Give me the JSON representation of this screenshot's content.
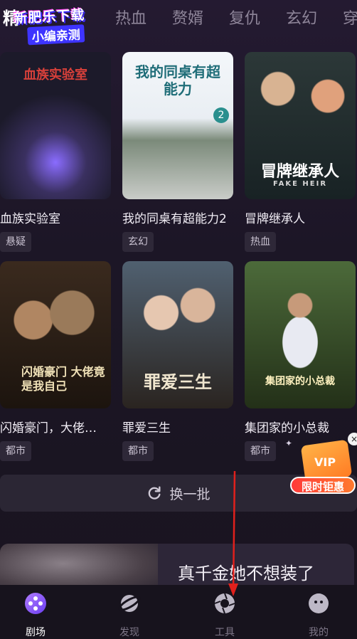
{
  "tabs": {
    "active_partial": "精",
    "items": [
      "热血",
      "赘婿",
      "复仇",
      "玄幻",
      "穿"
    ]
  },
  "watermark": {
    "line1": "新肥乐下载",
    "line2": "小编亲测"
  },
  "cards": [
    {
      "poster_text": "血族实验室",
      "title": "血族实验室",
      "tag": "悬疑"
    },
    {
      "poster_text": "我的同桌有超能力",
      "poster_sub": "2",
      "title": "我的同桌有超能力2",
      "tag": "玄幻"
    },
    {
      "poster_text": "冒牌继承人",
      "poster_sub": "FAKE HEIR",
      "title": "冒牌继承人",
      "tag": "热血"
    },
    {
      "poster_text": "闪婚豪门 大佬竟是我自己",
      "title": "闪婚豪门，大佬…",
      "tag": "都市"
    },
    {
      "poster_text": "罪爱三生",
      "title": "罪爱三生",
      "tag": "都市"
    },
    {
      "poster_text": "集团家的小总裁",
      "title": "集团家的小总裁",
      "tag": "都市"
    }
  ],
  "swap": {
    "label": "换一批",
    "icon": "refresh-icon"
  },
  "vip": {
    "badge": "VIP",
    "label": "限时钜惠",
    "close": "×"
  },
  "banner": {
    "title": "真千金她不想装了"
  },
  "nav": [
    {
      "label": "剧场",
      "icon": "theater-icon",
      "active": true
    },
    {
      "label": "发现",
      "icon": "planet-icon",
      "active": false
    },
    {
      "label": "工具",
      "icon": "aperture-icon",
      "active": false
    },
    {
      "label": "我的",
      "icon": "profile-icon",
      "active": false
    }
  ],
  "colors": {
    "accent": "#8a5cff",
    "annotation": "#e0201c"
  }
}
